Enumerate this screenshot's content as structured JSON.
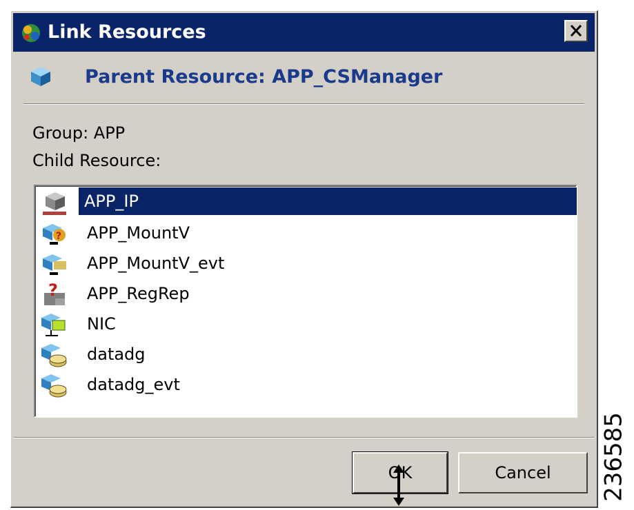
{
  "window": {
    "title": "Link Resources"
  },
  "header": {
    "parent_resource": "Parent Resource: APP_CSManager"
  },
  "group_label": "Group: APP",
  "child_resource_label": "Child Resource:",
  "resources": [
    {
      "label": "APP_IP",
      "icon": "ip-resource-icon",
      "selected": true
    },
    {
      "label": "APP_MountV",
      "icon": "mountv-resource-icon",
      "selected": false
    },
    {
      "label": "APP_MountV_evt",
      "icon": "mountv-evt-resource-icon",
      "selected": false
    },
    {
      "label": "APP_RegRep",
      "icon": "regrep-resource-icon",
      "selected": false
    },
    {
      "label": "NIC",
      "icon": "nic-resource-icon",
      "selected": false
    },
    {
      "label": "datadg",
      "icon": "diskgroup-resource-icon",
      "selected": false
    },
    {
      "label": "datadg_evt",
      "icon": "diskgroup-evt-resource-icon",
      "selected": false
    }
  ],
  "buttons": {
    "ok": "OK",
    "cancel": "Cancel"
  },
  "figure_id": "236585",
  "colors": {
    "titlebar": "#0a246a",
    "selection": "#0a246a",
    "header_text": "#1a3a8c",
    "dialog_bg": "#d4d0c8"
  }
}
